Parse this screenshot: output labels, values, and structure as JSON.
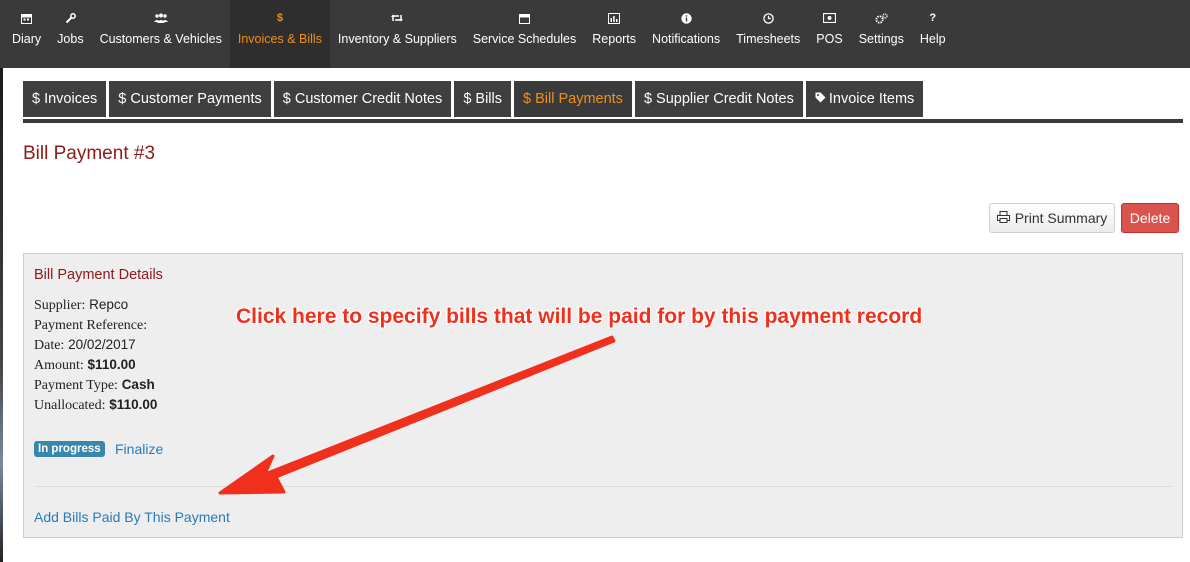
{
  "nav": {
    "items": [
      {
        "label": "Diary",
        "icon": "calendar-icon"
      },
      {
        "label": "Jobs",
        "icon": "wrench-icon"
      },
      {
        "label": "Customers & Vehicles",
        "icon": "users-icon"
      },
      {
        "label": "Invoices & Bills",
        "icon": "dollar-icon",
        "active": true
      },
      {
        "label": "Inventory & Suppliers",
        "icon": "retweet-icon"
      },
      {
        "label": "Service Schedules",
        "icon": "calendar-icon"
      },
      {
        "label": "Reports",
        "icon": "bar-chart-icon"
      },
      {
        "label": "Notifications",
        "icon": "info-icon"
      },
      {
        "label": "Timesheets",
        "icon": "clock-icon"
      },
      {
        "label": "POS",
        "icon": "money-icon"
      },
      {
        "label": "Settings",
        "icon": "gears-icon"
      },
      {
        "label": "Help",
        "icon": "question-icon"
      }
    ]
  },
  "tabs": [
    {
      "label": "$ Invoices"
    },
    {
      "label": "$ Customer Payments"
    },
    {
      "label": "$ Customer Credit Notes"
    },
    {
      "label": "$ Bills"
    },
    {
      "label": "$ Bill Payments",
      "active": true
    },
    {
      "label": "$ Supplier Credit Notes"
    },
    {
      "label": "Invoice Items",
      "icon": "tag-icon"
    }
  ],
  "page": {
    "title": "Bill Payment #3",
    "print_label": "Print Summary",
    "delete_label": "Delete"
  },
  "details": {
    "title": "Bill Payment Details",
    "supplier_label": "Supplier:",
    "supplier_value": "Repco",
    "reference_label": "Payment Reference:",
    "reference_value": "",
    "date_label": "Date:",
    "date_value": "20/02/2017",
    "amount_label": "Amount:",
    "amount_value": "$110.00",
    "type_label": "Payment Type:",
    "type_value": "Cash",
    "unallocated_label": "Unallocated:",
    "unallocated_value": "$110.00",
    "status_badge": "In progress",
    "finalize_label": "Finalize",
    "add_bills_label": "Add Bills Paid By This Payment"
  },
  "annotation": {
    "text": "Click here to specify bills that will be paid for by this payment record"
  },
  "colors": {
    "nav_bg": "#3a3a3a",
    "accent": "#f0901c",
    "title_red": "#8b1a1a",
    "link_blue": "#2a7ab8",
    "badge_blue": "#3a87ad",
    "delete_red": "#d9534f",
    "annotation_red": "#f0301c"
  }
}
